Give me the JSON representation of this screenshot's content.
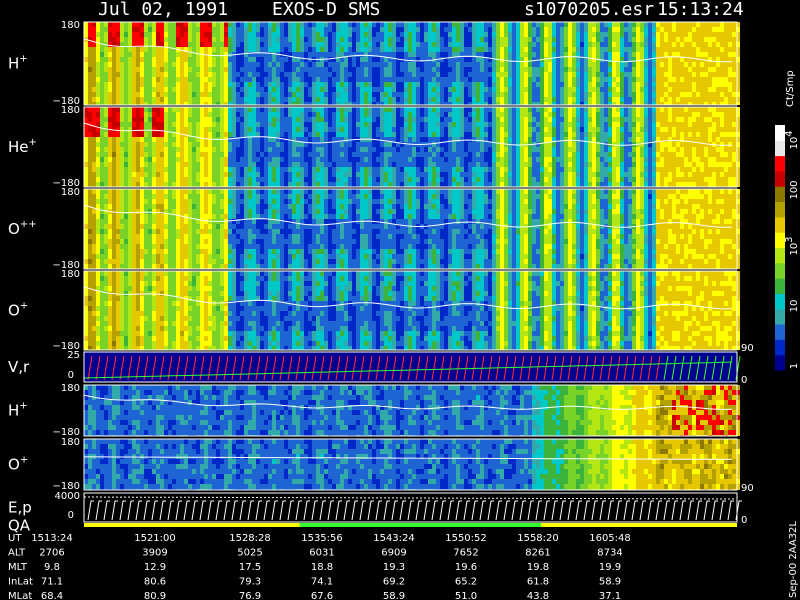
{
  "header": {
    "date": "Jul 02, 1991",
    "instrument": "EXOS-D SMS",
    "file": "s1070205.esr",
    "time": "15:13:24"
  },
  "colors": {
    "background": "#000000",
    "scale": [
      "#000090",
      "#0028c8",
      "#1e64d2",
      "#32aaaa",
      "#00c8c8",
      "#3cb43c",
      "#78d228",
      "#b4e614",
      "#ffff00",
      "#e6c800",
      "#b4a000",
      "#8c7800",
      "#c80000",
      "#ff0000",
      "#e8e8e8",
      "#ffffff"
    ],
    "trace": "#ffffff",
    "vr_red": "#ff3030",
    "vr_green": "#30ff30",
    "qa_yellow": "#ffff00",
    "qa_green": "#30ff30"
  },
  "chart_data": {
    "type": "heatmap",
    "panels": [
      {
        "id": "h-plus",
        "label": "H",
        "label_sup": "+",
        "y_max": "180",
        "y_min": "−180",
        "kind": "heatmap"
      },
      {
        "id": "he-plus",
        "label": "He",
        "label_sup": "+",
        "y_max": "180",
        "y_min": "−180",
        "kind": "heatmap"
      },
      {
        "id": "o-plus-plus",
        "label": "O",
        "label_sup": "++",
        "y_max": "180",
        "y_min": "−180",
        "kind": "heatmap"
      },
      {
        "id": "o-plus",
        "label": "O",
        "label_sup": "+",
        "y_max": "180",
        "y_min": "−180",
        "kind": "heatmap",
        "right_tick": "90"
      },
      {
        "id": "vr",
        "label": "V,r",
        "y_max": "25",
        "y_zero": "0",
        "kind": "vr",
        "right_tick": "0"
      },
      {
        "id": "h-plus-2",
        "label": "H",
        "label_sup": "+",
        "y_max": "180",
        "y_min": "−180",
        "kind": "heatmap"
      },
      {
        "id": "o-plus-2",
        "label": "O",
        "label_sup": "+",
        "y_max": "180",
        "y_min": "−180",
        "kind": "heatmap",
        "right_tick": "90"
      },
      {
        "id": "ep-qa",
        "label": "E,p",
        "label2": "QA",
        "y_max": "4000",
        "y_zero": "0",
        "kind": "ep",
        "right_tick": "0"
      }
    ],
    "colorbar": {
      "title": "Ct/Smp",
      "tick_labels": [
        "10",
        "100",
        "10",
        "10",
        "1"
      ],
      "tick_sups": [
        "4",
        "",
        "3",
        "",
        ""
      ],
      "tick_values": [
        10000,
        1000,
        100,
        10,
        1
      ],
      "scale": "log"
    },
    "time_table": {
      "rows": [
        {
          "name": "UT",
          "values": [
            "1513:24",
            "1521:00",
            "1528:28",
            "1535:56",
            "1543:24",
            "1550:52",
            "1558:20",
            "1605:48"
          ]
        },
        {
          "name": "ALT",
          "values": [
            "2706",
            "3909",
            "5025",
            "6031",
            "6909",
            "7652",
            "8261",
            "8734"
          ]
        },
        {
          "name": "MLT",
          "values": [
            "9.8",
            "12.9",
            "17.5",
            "18.8",
            "19.3",
            "19.6",
            "19.8",
            "19.9"
          ]
        },
        {
          "name": "InLat",
          "values": [
            "71.1",
            "80.6",
            "79.3",
            "74.1",
            "69.2",
            "65.2",
            "61.8",
            "58.9"
          ]
        },
        {
          "name": "MLat",
          "values": [
            "68.4",
            "80.9",
            "76.9",
            "67.6",
            "58.9",
            "51.0",
            "43.8",
            "37.1"
          ]
        }
      ]
    },
    "footer_id": "Sep-00 2AA32L"
  }
}
